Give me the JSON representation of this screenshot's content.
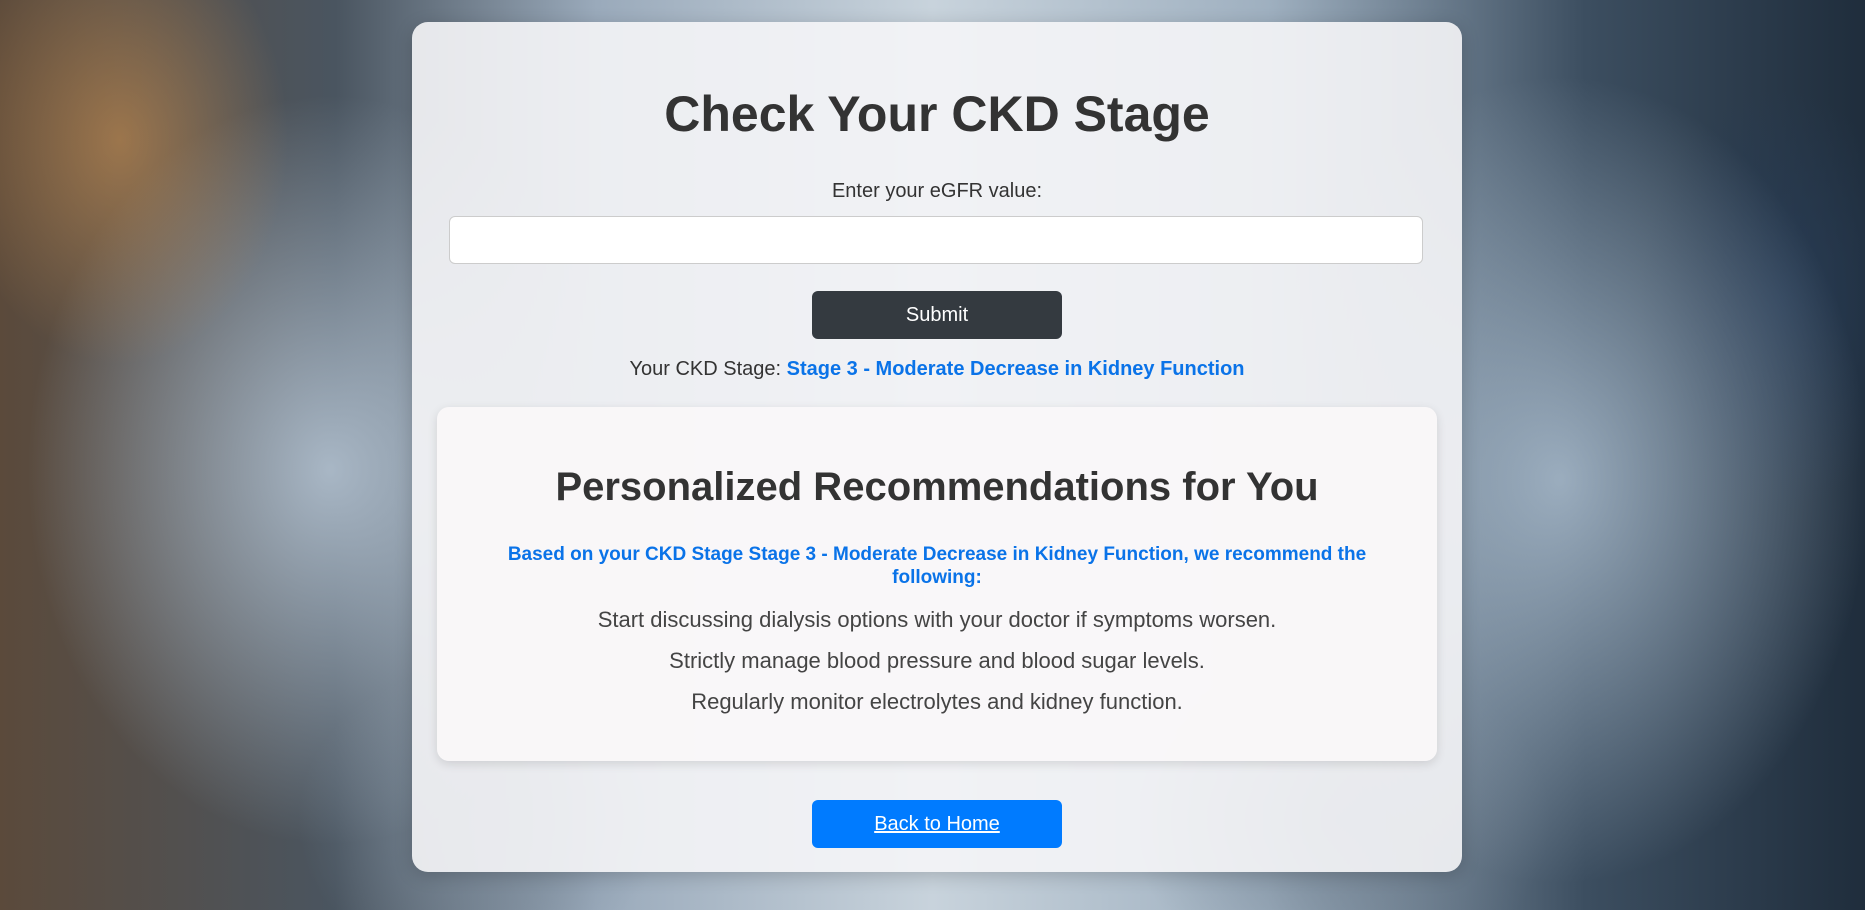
{
  "page": {
    "title": "Check Your CKD Stage"
  },
  "form": {
    "label": "Enter your eGFR value:",
    "input_value": "",
    "input_placeholder": "",
    "submit_label": "Submit"
  },
  "result": {
    "prefix": "Your CKD Stage:",
    "stage": "Stage 3 - Moderate Decrease in Kidney Function"
  },
  "recommendations": {
    "title": "Personalized Recommendations for You",
    "intro": "Based on your CKD Stage Stage 3 - Moderate Decrease in Kidney Function, we recommend the following:",
    "items": [
      "Start discussing dialysis options with your doctor if symptoms worsen.",
      "Strictly manage blood pressure and blood sugar levels.",
      "Regularly monitor electrolytes and kidney function."
    ]
  },
  "nav": {
    "home_label": "Back to Home"
  },
  "colors": {
    "accent": "#0a73e8",
    "submit_button": "#343a40",
    "home_button": "#007bff"
  }
}
